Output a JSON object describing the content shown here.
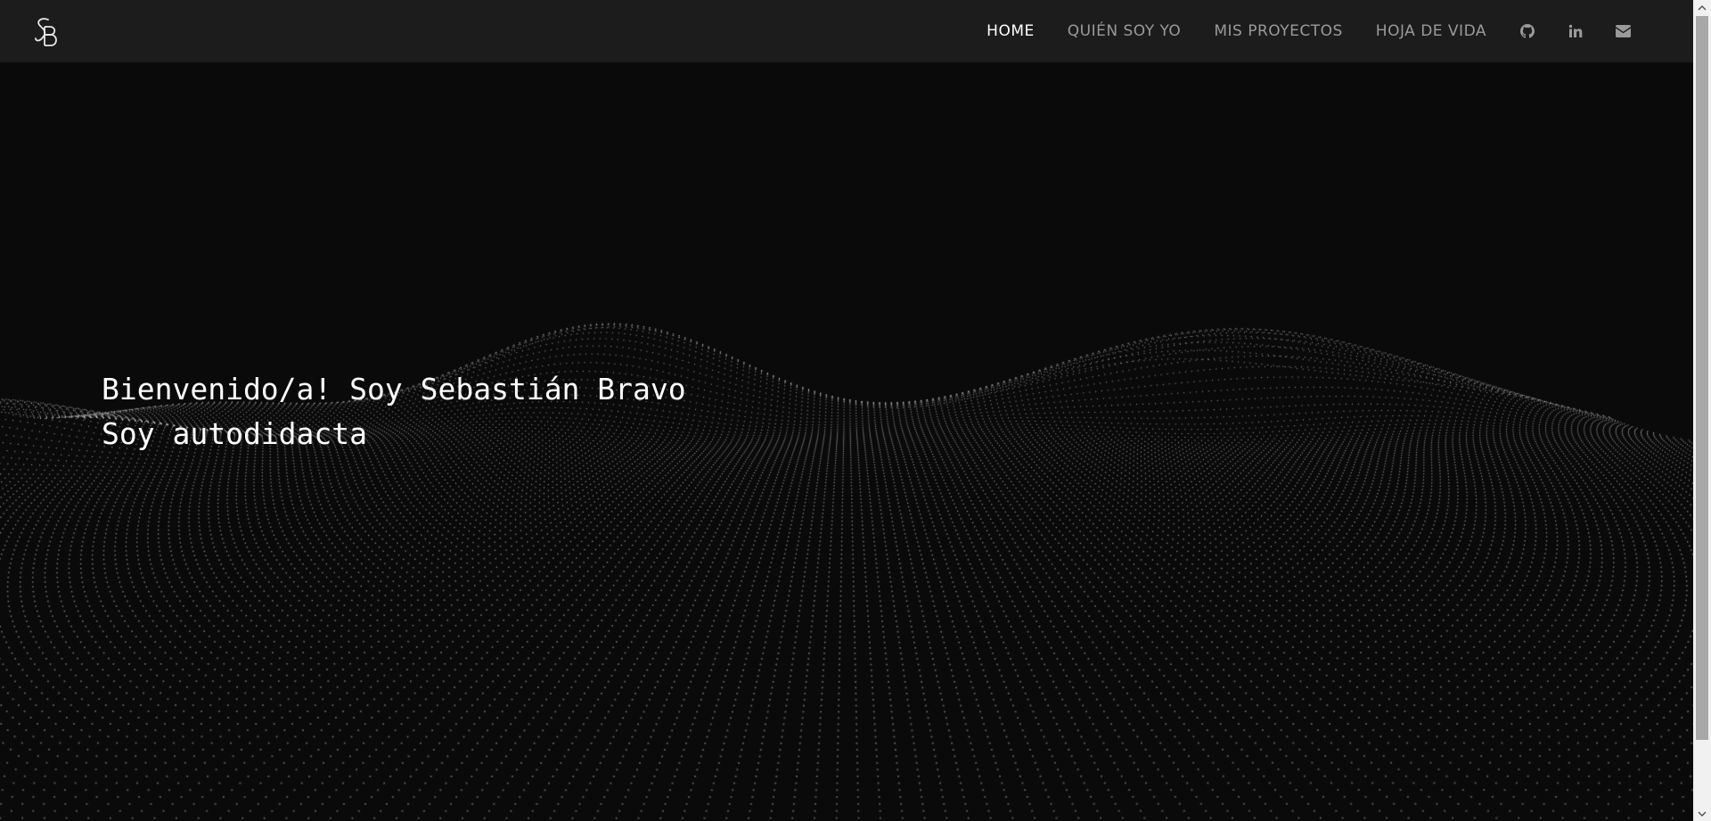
{
  "brand": {
    "logo_icon": "sb-monogram-logo"
  },
  "nav": {
    "links": [
      {
        "label": "HOME",
        "active": true
      },
      {
        "label": "QUIÉN SOY YO",
        "active": false
      },
      {
        "label": "MIS PROYECTOS",
        "active": false
      },
      {
        "label": "HOJA DE VIDA",
        "active": false
      }
    ],
    "icons": [
      "github-icon",
      "linkedin-icon",
      "envelope-icon"
    ]
  },
  "hero": {
    "line1": "Bienvenido/a! Soy Sebastián Bravo",
    "line2": "Soy autodidacta",
    "background": "particle-wave"
  },
  "colors": {
    "background": "#0a0a0a",
    "navbar": "#1c1c1c",
    "nav_text": "#9a9a9a",
    "nav_active": "#ffffff",
    "hero_text": "#ffffff",
    "particles": "#d8d8d8"
  }
}
